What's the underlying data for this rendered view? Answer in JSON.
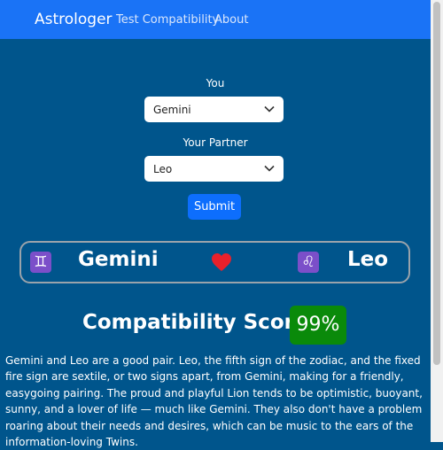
{
  "navbar": {
    "brand": "Astrologer",
    "links": [
      "Test Compatibility",
      "About"
    ]
  },
  "form": {
    "you_label": "You",
    "you_value": "Gemini",
    "partner_label": "Your Partner",
    "partner_value": "Leo",
    "submit_label": "Submit"
  },
  "pair": {
    "you_sign": "Gemini",
    "you_symbol": "♊",
    "partner_sign": "Leo",
    "partner_symbol": "♌"
  },
  "score": {
    "title": "Compatibility Score:",
    "value": "99%"
  },
  "description": "Gemini and Leo are a good pair. Leo, the fifth sign of the zodiac, and the fixed fire sign are sextile, or two signs apart, from Gemini, making for a friendly, easygoing pairing. The proud and playful Lion tends to be optimistic, buoyant, sunny, and a lover of life — much like Gemini. They also don't have a problem roaring about their needs and desires, which can be music to the ears of the information-loving Twins.",
  "colors": {
    "page_bg": "#00558c",
    "navbar_bg": "#1a73f6",
    "button_bg": "#0d6efd",
    "score_badge_bg": "#0a8a0a",
    "zodiac_icon_bg": "#7b4fc9",
    "heart": "#e8212b"
  }
}
